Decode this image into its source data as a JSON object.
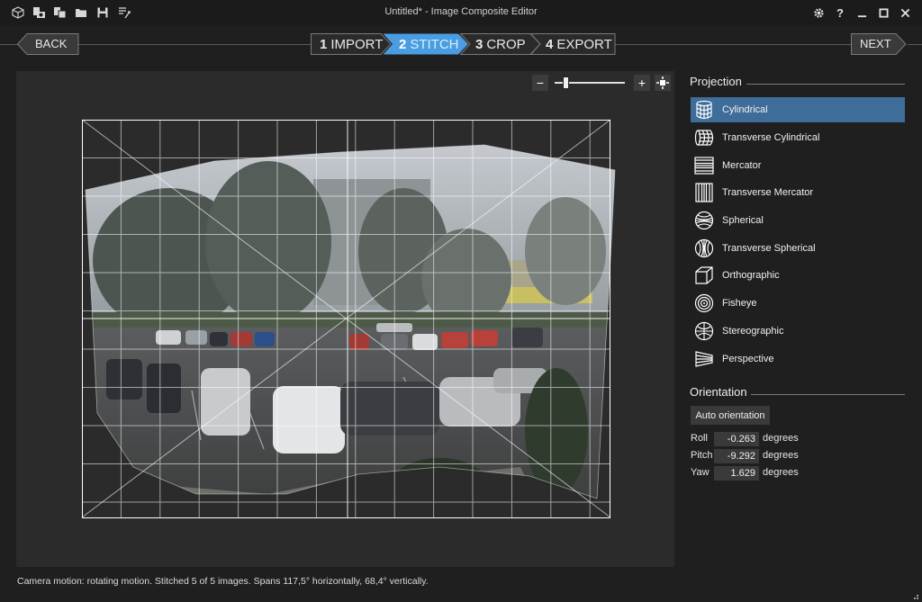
{
  "window": {
    "title": "Untitled* - Image Composite Editor"
  },
  "titlebar_icons": [
    "new-project-icon",
    "new-from-camera-icon",
    "new-from-images-icon",
    "open-icon",
    "save-icon",
    "export-icon"
  ],
  "nav": {
    "back_label": "BACK",
    "next_label": "NEXT",
    "steps": [
      {
        "num": "1",
        "label": "IMPORT",
        "active": false
      },
      {
        "num": "2",
        "label": "STITCH",
        "active": true
      },
      {
        "num": "3",
        "label": "CROP",
        "active": false
      },
      {
        "num": "4",
        "label": "EXPORT",
        "active": false
      }
    ]
  },
  "zoom": {
    "minus": "−",
    "plus": "+",
    "level_fraction": 0.13
  },
  "projection": {
    "title": "Projection",
    "items": [
      {
        "label": "Cylindrical",
        "icon": "cylindrical-icon",
        "selected": true
      },
      {
        "label": "Transverse Cylindrical",
        "icon": "transverse-cylindrical-icon",
        "selected": false
      },
      {
        "label": "Mercator",
        "icon": "mercator-icon",
        "selected": false
      },
      {
        "label": "Transverse Mercator",
        "icon": "transverse-mercator-icon",
        "selected": false
      },
      {
        "label": "Spherical",
        "icon": "spherical-icon",
        "selected": false
      },
      {
        "label": "Transverse Spherical",
        "icon": "transverse-spherical-icon",
        "selected": false
      },
      {
        "label": "Orthographic",
        "icon": "orthographic-icon",
        "selected": false
      },
      {
        "label": "Fisheye",
        "icon": "fisheye-icon",
        "selected": false
      },
      {
        "label": "Stereographic",
        "icon": "stereographic-icon",
        "selected": false
      },
      {
        "label": "Perspective",
        "icon": "perspective-icon",
        "selected": false
      }
    ]
  },
  "orientation": {
    "title": "Orientation",
    "auto_label": "Auto orientation",
    "roll": {
      "label": "Roll",
      "value": "-0.263",
      "unit": "degrees"
    },
    "pitch": {
      "label": "Pitch",
      "value": "-9.292",
      "unit": "degrees"
    },
    "yaw": {
      "label": "Yaw",
      "value": "1.629",
      "unit": "degrees"
    }
  },
  "status": "Camera motion: rotating motion. Stitched 5 of 5 images. Spans 117,5° horizontally, 68,4° vertically.",
  "colors": {
    "selected": "#3e6d99",
    "active_step": "#4a9de0",
    "background": "#1f1f1f",
    "canvas": "#2b2b2b"
  }
}
